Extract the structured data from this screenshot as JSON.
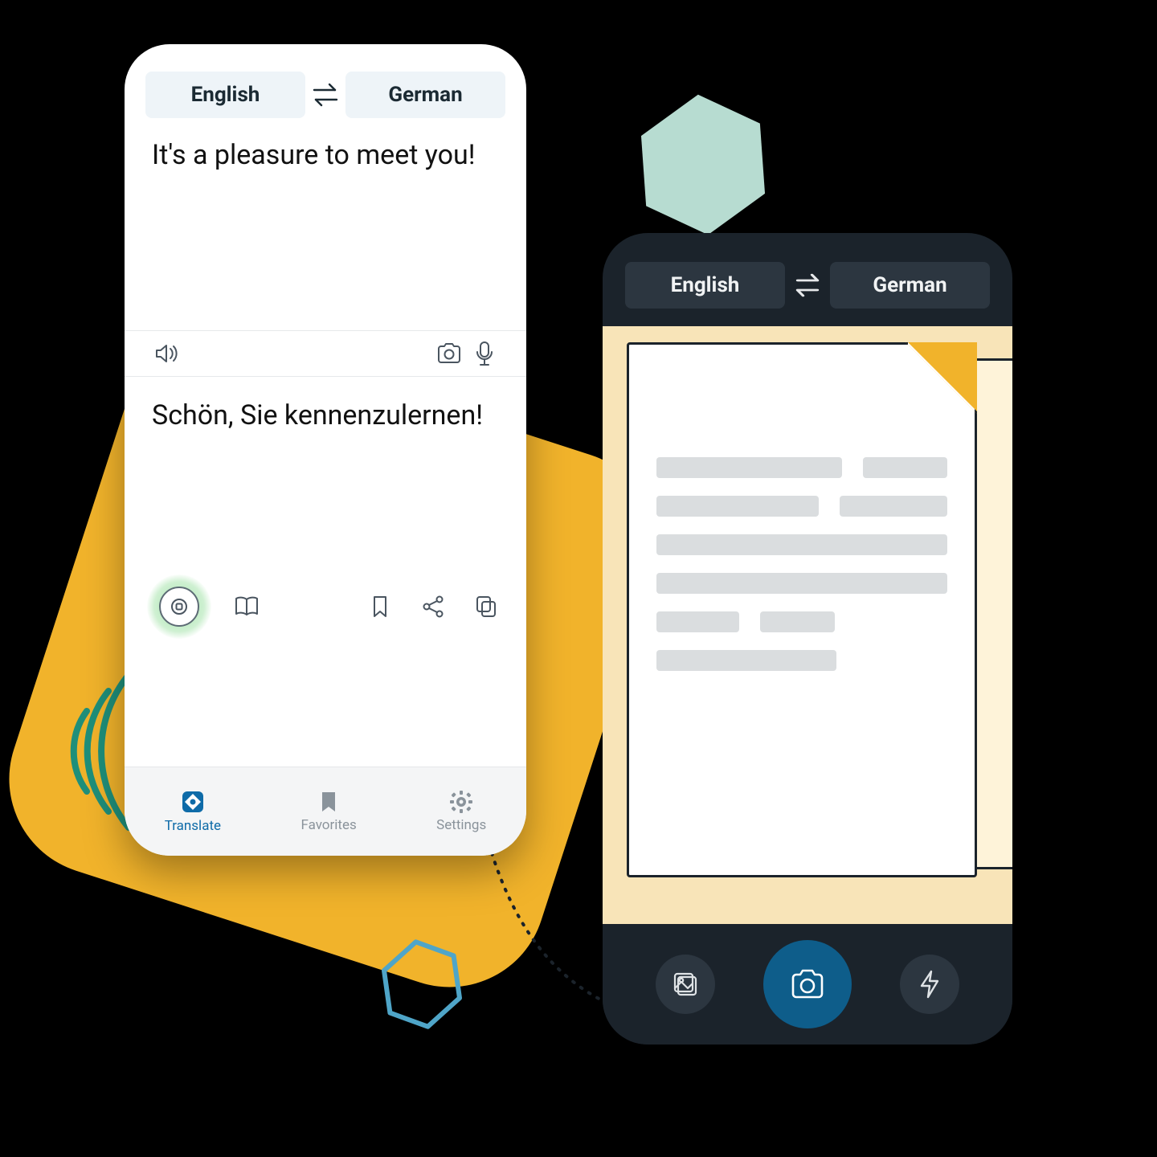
{
  "colors": {
    "yellow": "#F1B32B",
    "teal": "#B7DCD1",
    "bluehex": "#4FA5C8",
    "accent_blue": "#0E6BA8",
    "dark": "#1B232B"
  },
  "phone_light": {
    "lang_source": "English",
    "lang_target": "German",
    "source_text": "It's a pleasure to meet you!",
    "target_text": "Schön, Sie kennenzulernen!",
    "nav": {
      "translate": "Translate",
      "favorites": "Favorites",
      "settings": "Settings"
    }
  },
  "phone_dark": {
    "lang_source": "English",
    "lang_target": "German"
  }
}
